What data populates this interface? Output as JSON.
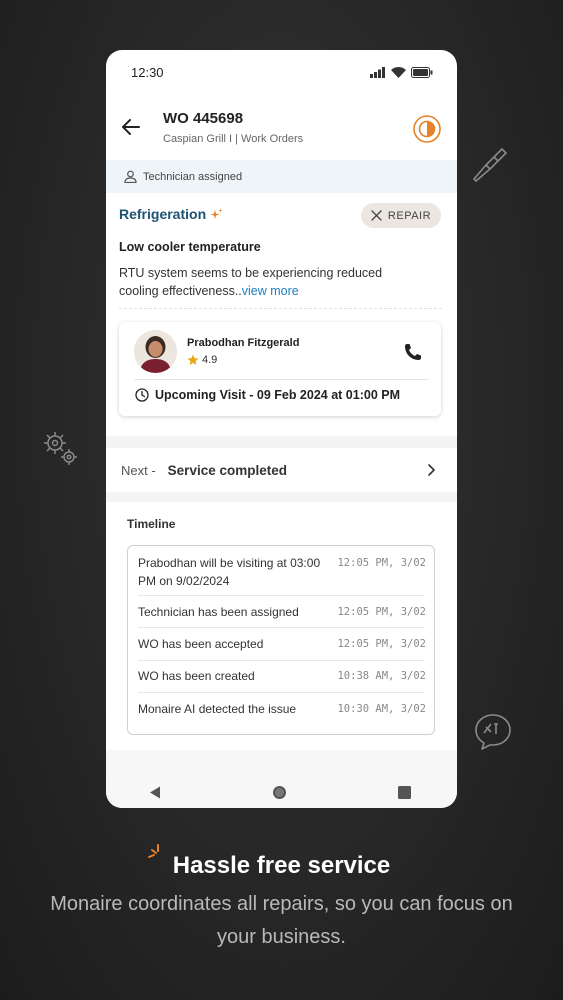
{
  "statusbar": {
    "time": "12:30"
  },
  "header": {
    "title": "WO 445698",
    "subtitle": "Caspian Grill I | Work Orders"
  },
  "banner": {
    "text": "Technician assigned"
  },
  "issue": {
    "category": "Refrigeration",
    "chip_label": "REPAIR",
    "title": "Low cooler temperature",
    "description": "RTU system seems to be experiencing reduced cooling effectiveness..",
    "view_more": "view more"
  },
  "technician": {
    "name": "Prabodhan Fitzgerald",
    "rating": "4.9",
    "visit": "Upcoming Visit - 09 Feb 2024 at 01:00 PM"
  },
  "next_step": {
    "label": "Next -",
    "value": "Service completed"
  },
  "timeline": {
    "title": "Timeline",
    "items": [
      {
        "text": "Prabodhan will be visiting at 03:00 PM on 9/02/2024",
        "time": "12:05 PM, 3/02"
      },
      {
        "text": "Technician has been assigned",
        "time": "12:05 PM, 3/02"
      },
      {
        "text": "WO has been accepted",
        "time": "12:05 PM, 3/02"
      },
      {
        "text": "WO has been created",
        "time": "10:38 AM, 3/02"
      },
      {
        "text": "Monaire AI  detected the issue",
        "time": "10:30 AM, 3/02"
      }
    ]
  },
  "promo": {
    "headline": "Hassle free service",
    "subline": "Monaire coordinates all repairs, so you can focus on your business."
  },
  "colors": {
    "accent_orange": "#e8822a",
    "category_blue": "#1d5275",
    "link_blue": "#1e7fbf",
    "star_gold": "#e6a817"
  }
}
